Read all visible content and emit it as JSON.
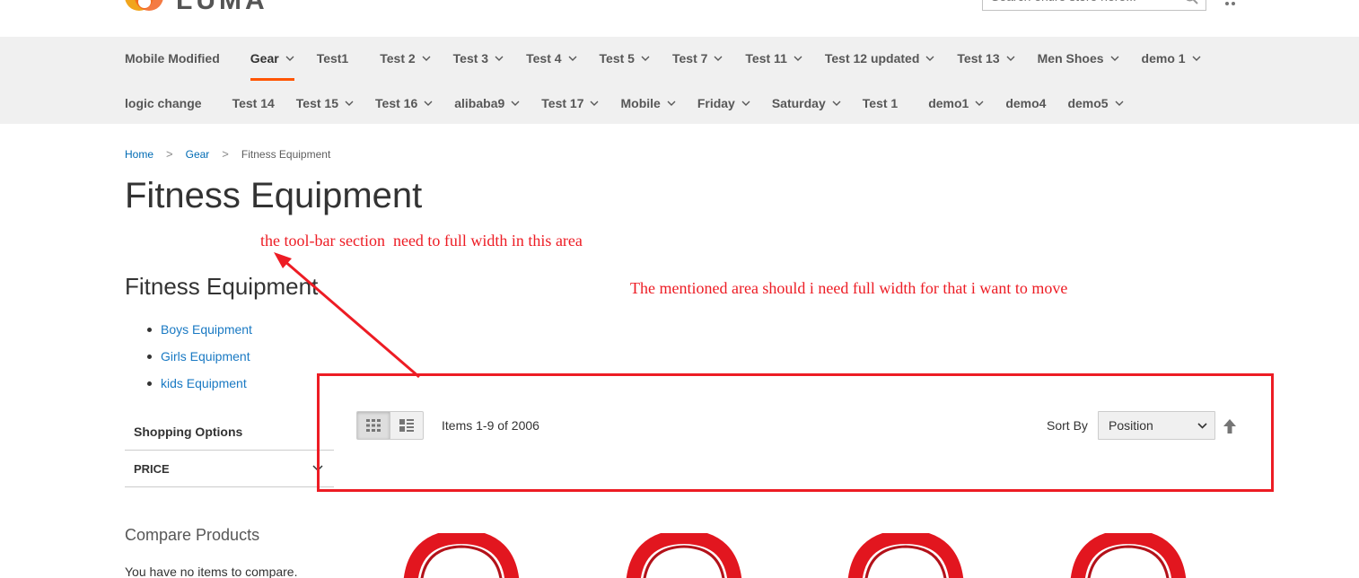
{
  "header": {
    "logo_text": "LUMA",
    "search_placeholder": "Search entire store here..."
  },
  "nav": {
    "row1": [
      {
        "label": "Mobile Modified",
        "chevron": false,
        "active": false
      },
      {
        "label": "Gear",
        "chevron": true,
        "active": true
      },
      {
        "label": "Test1",
        "chevron": false,
        "active": false
      },
      {
        "label": "Test 2",
        "chevron": true,
        "active": false
      },
      {
        "label": "Test 3",
        "chevron": true,
        "active": false
      },
      {
        "label": "Test 4",
        "chevron": true,
        "active": false
      },
      {
        "label": "Test 5",
        "chevron": true,
        "active": false
      },
      {
        "label": "Test 7",
        "chevron": true,
        "active": false
      },
      {
        "label": "Test 11",
        "chevron": true,
        "active": false
      },
      {
        "label": "Test 12 updated",
        "chevron": true,
        "active": false
      },
      {
        "label": "Test 13",
        "chevron": true,
        "active": false
      },
      {
        "label": "Men Shoes",
        "chevron": true,
        "active": false
      },
      {
        "label": "demo 1",
        "chevron": true,
        "active": false
      }
    ],
    "row2": [
      {
        "label": "logic change",
        "chevron": false,
        "active": false
      },
      {
        "label": "Test 14",
        "chevron": false,
        "active": false
      },
      {
        "label": "Test 15",
        "chevron": true,
        "active": false
      },
      {
        "label": "Test 16",
        "chevron": true,
        "active": false
      },
      {
        "label": "alibaba9",
        "chevron": true,
        "active": false
      },
      {
        "label": "Test 17",
        "chevron": true,
        "active": false
      },
      {
        "label": "Mobile",
        "chevron": true,
        "active": false
      },
      {
        "label": "Friday",
        "chevron": true,
        "active": false
      },
      {
        "label": "Saturday",
        "chevron": true,
        "active": false
      },
      {
        "label": "Test 1",
        "chevron": false,
        "active": false
      },
      {
        "label": "demo1",
        "chevron": true,
        "active": false
      },
      {
        "label": "demo4",
        "chevron": false,
        "active": false
      },
      {
        "label": "demo5",
        "chevron": true,
        "active": false
      }
    ]
  },
  "breadcrumb": {
    "home": "Home",
    "gear": "Gear",
    "current": "Fitness Equipment",
    "separator": ">"
  },
  "page_title": "Fitness Equipment",
  "sidebar": {
    "category_title": "Fitness Equipment",
    "categories": [
      "Boys Equipment",
      "Girls Equipment",
      "kids Equipment"
    ],
    "shopping_options_title": "Shopping Options",
    "filter_price": "PRICE",
    "compare_title": "Compare Products",
    "compare_text": "You have no items to compare."
  },
  "toolbar": {
    "items_count": "Items 1-9 of 2006",
    "sort_label": "Sort By",
    "sort_value": "Position"
  },
  "annotations": {
    "note1": "the tool-bar section  need to full width in this area",
    "note2": "The mentioned area should i need full width for that i want to move",
    "color": "#ed1c24"
  },
  "colors": {
    "nav_bg": "#f0f0f0",
    "active_underline": "#ff5501",
    "link": "#1979c3",
    "product_red": "#e2161f"
  }
}
